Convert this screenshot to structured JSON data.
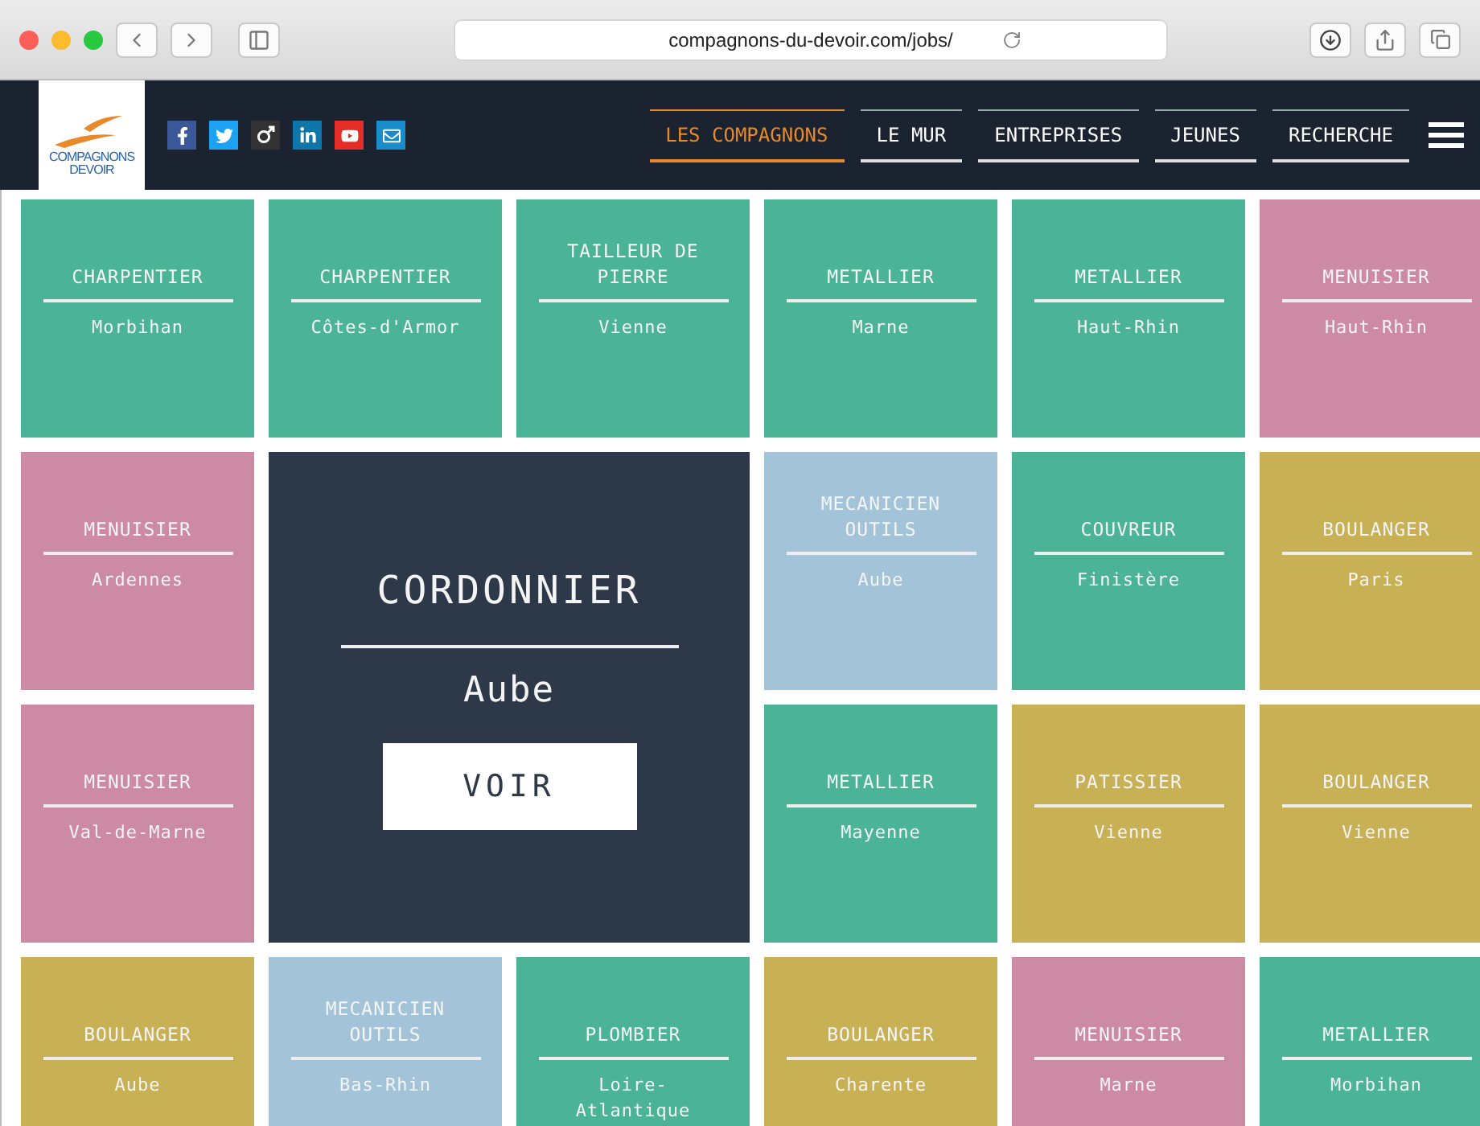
{
  "browser": {
    "url": "compagnons-du-devoir.com/jobs/"
  },
  "logo": {
    "lines": [
      "COMPAGNONS",
      "DEVOIR"
    ]
  },
  "nav": [
    {
      "label": "LES COMPAGNONS",
      "selected": true
    },
    {
      "label": "LE MUR",
      "selected": false
    },
    {
      "label": "ENTREPRISES",
      "selected": false
    },
    {
      "label": "JEUNES",
      "selected": false
    },
    {
      "label": "RECHERCHE",
      "selected": false
    }
  ],
  "tiles": [
    {
      "kind": "job",
      "title": "CHARPENTIER",
      "place": "Morbihan",
      "color": "#4bb396"
    },
    {
      "kind": "job",
      "title": "CHARPENTIER",
      "place": "Côtes-d'Armor",
      "color": "#4bb396"
    },
    {
      "kind": "job",
      "title": "TAILLEUR DE PIERRE",
      "place": "Vienne",
      "color": "#4bb396"
    },
    {
      "kind": "job",
      "title": "METALLIER",
      "place": "Marne",
      "color": "#4bb396"
    },
    {
      "kind": "job",
      "title": "METALLIER",
      "place": "Haut-Rhin",
      "color": "#4bb396"
    },
    {
      "kind": "job",
      "title": "MENUISIER",
      "place": "Haut-Rhin",
      "color": "#cc8aa5"
    },
    {
      "kind": "job",
      "title": "MENUISIER",
      "place": "Ardennes",
      "color": "#cc8aa5"
    },
    {
      "kind": "featured",
      "title": "CORDONNIER",
      "place": "Aube",
      "button": "VOIR",
      "color": "#2d3848"
    },
    {
      "kind": "job",
      "title": "MECANICIEN OUTILS",
      "place": "Aube",
      "color": "#a3c4d8"
    },
    {
      "kind": "job",
      "title": "COUVREUR",
      "place": "Finistère",
      "color": "#4bb396"
    },
    {
      "kind": "job",
      "title": "BOULANGER",
      "place": "Paris",
      "color": "#c8b055"
    },
    {
      "kind": "job",
      "title": "MENUISIER",
      "place": "Val-de-Marne",
      "color": "#cc8aa5"
    },
    {
      "kind": "job",
      "title": "METALLIER",
      "place": "Mayenne",
      "color": "#4bb396"
    },
    {
      "kind": "job",
      "title": "PATISSIER",
      "place": "Vienne",
      "color": "#c8b055"
    },
    {
      "kind": "job",
      "title": "BOULANGER",
      "place": "Vienne",
      "color": "#c8b055"
    },
    {
      "kind": "job",
      "title": "BOULANGER",
      "place": "Aube",
      "color": "#c8b055"
    },
    {
      "kind": "job",
      "title": "MECANICIEN OUTILS",
      "place": "Bas-Rhin",
      "color": "#a3c4d8"
    },
    {
      "kind": "job",
      "title": "PLOMBIER",
      "place": "Loire-Atlantique",
      "color": "#4bb396"
    },
    {
      "kind": "job",
      "title": "BOULANGER",
      "place": "Charente",
      "color": "#c8b055"
    },
    {
      "kind": "job",
      "title": "MENUISIER",
      "place": "Marne",
      "color": "#cc8aa5"
    },
    {
      "kind": "job",
      "title": "METALLIER",
      "place": "Morbihan",
      "color": "#4bb396"
    }
  ]
}
